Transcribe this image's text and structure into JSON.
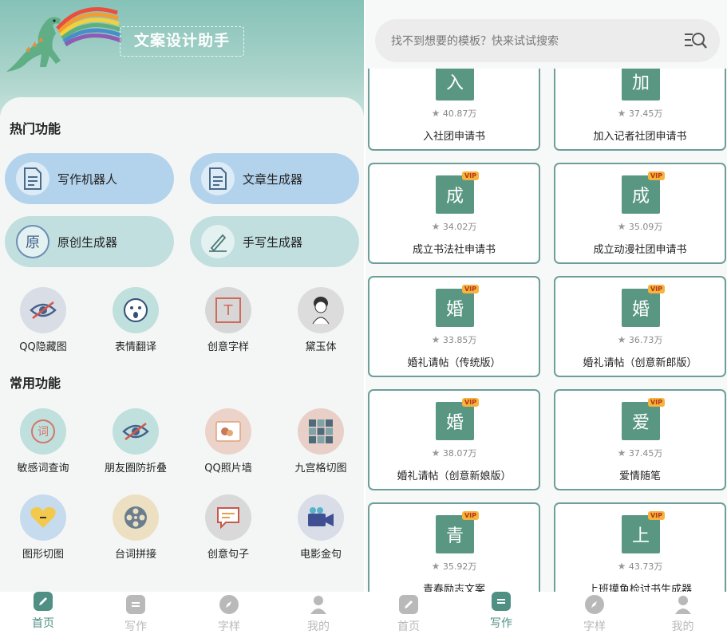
{
  "left": {
    "app_title": "文案设计助手",
    "hot_title": "热门功能",
    "hot_pills": [
      {
        "label": "写作机器人",
        "icon": "document-icon",
        "color": "#b3d3ec"
      },
      {
        "label": "文章生成器",
        "icon": "document-icon",
        "color": "#b3d3ec"
      },
      {
        "label": "原创生成器",
        "icon": "original-badge-icon",
        "glyph": "原",
        "color": "#c2dfe0"
      },
      {
        "label": "手写生成器",
        "icon": "pen-icon",
        "color": "#c2dfe0"
      }
    ],
    "hot_grid": [
      {
        "label": "QQ隐藏图",
        "icon": "eye-slash-icon",
        "bg": "#d9dee6"
      },
      {
        "label": "表情翻译",
        "icon": "emoji-face-icon",
        "bg": "#bfe0dc"
      },
      {
        "label": "创意字样",
        "icon": "text-frame-icon",
        "glyph": "T",
        "bg": "#d7d7d7"
      },
      {
        "label": "黛玉体",
        "icon": "lady-portrait-icon",
        "bg": "#dcdcdc"
      }
    ],
    "common_title": "常用功能",
    "common_grid": [
      {
        "label": "敏感词查询",
        "icon": "word-search-icon",
        "glyph": "词",
        "bg": "#bfe0dc"
      },
      {
        "label": "朋友圈防折叠",
        "icon": "eye-slash-icon",
        "bg": "#bfe0dc"
      },
      {
        "label": "QQ照片墙",
        "icon": "photo-wall-icon",
        "bg": "#ecd3c9"
      },
      {
        "label": "九宫格切图",
        "icon": "grid-cut-icon",
        "bg": "#e8d0c8"
      },
      {
        "label": "图形切图",
        "icon": "heart-shape-icon",
        "bg": "#c7dbee"
      },
      {
        "label": "台词拼接",
        "icon": "film-reel-icon",
        "bg": "#ede0c2"
      },
      {
        "label": "创意句子",
        "icon": "chat-bubble-icon",
        "bg": "#d9d9d9"
      },
      {
        "label": "电影金句",
        "icon": "movie-camera-icon",
        "bg": "#d9dde8"
      }
    ]
  },
  "nav": {
    "tabs": [
      {
        "label": "首页",
        "icon": "edit-icon"
      },
      {
        "label": "写作",
        "icon": "writing-icon"
      },
      {
        "label": "字样",
        "icon": "compass-icon"
      },
      {
        "label": "我的",
        "icon": "user-icon"
      }
    ],
    "active_left": 0,
    "active_right": 1,
    "active_color": "#4f8f84",
    "inactive_color": "#b9b9b9"
  },
  "right": {
    "search_placeholder": "找不到想要的模板？快来试试搜索",
    "search_icon": "list-search-icon",
    "templates": [
      {
        "glyph": "入",
        "rating": "40.87万",
        "name": "入社团申请书",
        "vip": false
      },
      {
        "glyph": "加",
        "rating": "37.45万",
        "name": "加入记者社团申请书",
        "vip": false
      },
      {
        "glyph": "成",
        "rating": "34.02万",
        "name": "成立书法社申请书",
        "vip": true
      },
      {
        "glyph": "成",
        "rating": "35.09万",
        "name": "成立动漫社团申请书",
        "vip": true
      },
      {
        "glyph": "婚",
        "rating": "33.85万",
        "name": "婚礼请帖（传统版）",
        "vip": true
      },
      {
        "glyph": "婚",
        "rating": "36.73万",
        "name": "婚礼请帖（创意新郎版）",
        "vip": true
      },
      {
        "glyph": "婚",
        "rating": "38.07万",
        "name": "婚礼请帖（创意新娘版）",
        "vip": true
      },
      {
        "glyph": "爱",
        "rating": "37.45万",
        "name": "爱情随笔",
        "vip": true
      },
      {
        "glyph": "青",
        "rating": "35.92万",
        "name": "青春励志文案",
        "vip": true
      },
      {
        "glyph": "上",
        "rating": "43.73万",
        "name": "上班摸鱼检讨书生成器",
        "vip": true
      }
    ],
    "vip_label": "VIP",
    "star": "★"
  }
}
